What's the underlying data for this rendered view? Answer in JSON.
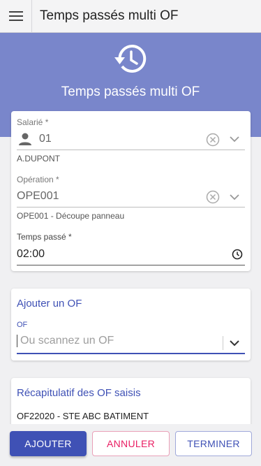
{
  "appbar": {
    "title": "Temps passés multi OF",
    "menu_icon": "menu-icon"
  },
  "hero": {
    "title": "Temps passés multi OF",
    "icon": "history-icon"
  },
  "form": {
    "salarie": {
      "label": "Salarié *",
      "value": "01",
      "hint": "A.DUPONT"
    },
    "operation": {
      "label": "Opération *",
      "value": "OPE001",
      "hint": "OPE001 - Découpe panneau"
    },
    "temps": {
      "label": "Temps passé *",
      "value": "02:00"
    }
  },
  "add_of": {
    "heading": "Ajouter un OF",
    "label": "OF",
    "placeholder": "Ou scannez un OF"
  },
  "summary": {
    "heading": "Récapitulatif des OF saisis",
    "items": [
      "OF22020 - STE ABC BATIMENT"
    ]
  },
  "buttons": {
    "add": "AJOUTER",
    "cancel": "ANNULER",
    "finish": "TERMINER"
  },
  "colors": {
    "primary": "#3f51b5",
    "hero": "#7986cb",
    "accent": "#e91e63"
  }
}
